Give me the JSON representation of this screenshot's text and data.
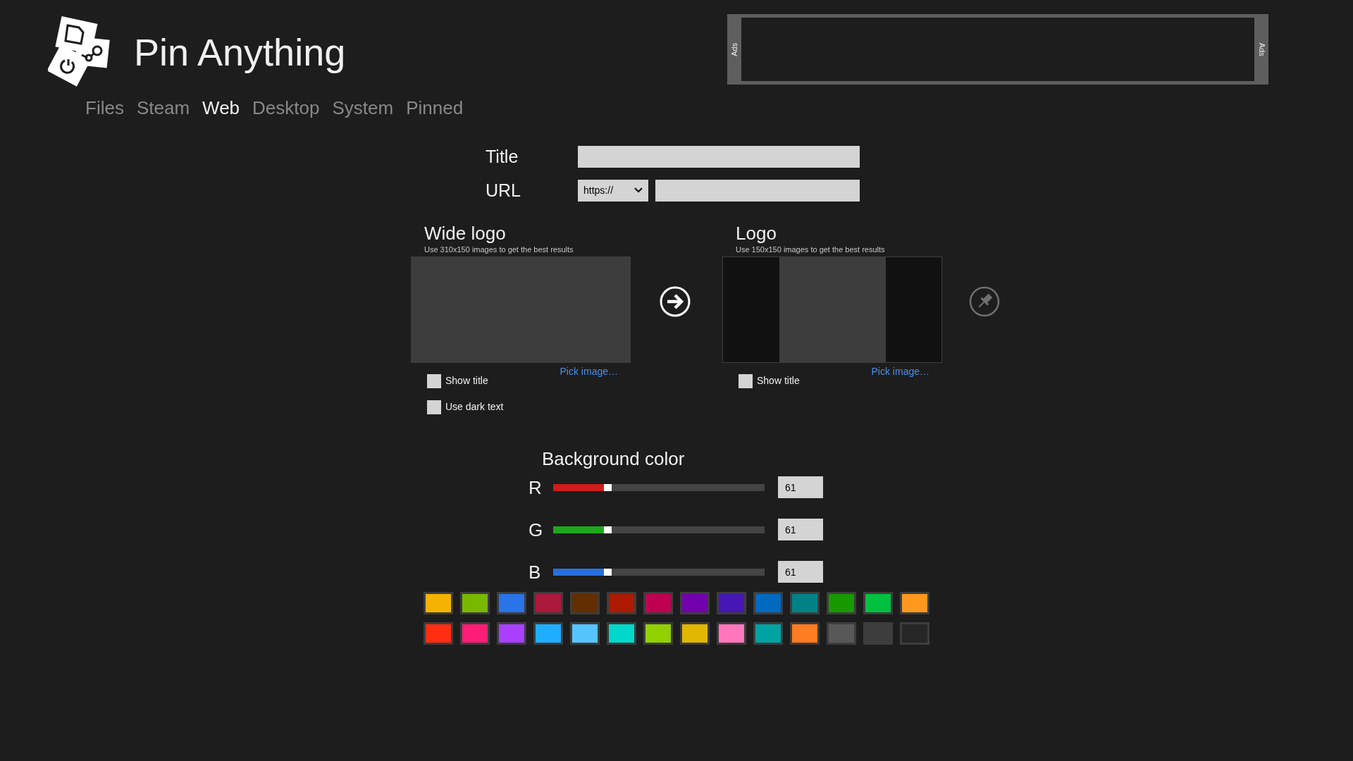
{
  "app": {
    "title": "Pin Anything"
  },
  "tabs": [
    {
      "label": "Files",
      "selected": false
    },
    {
      "label": "Steam",
      "selected": false
    },
    {
      "label": "Web",
      "selected": true
    },
    {
      "label": "Desktop",
      "selected": false
    },
    {
      "label": "System",
      "selected": false
    },
    {
      "label": "Pinned",
      "selected": false
    }
  ],
  "ads": {
    "left_label": "Ads",
    "right_label": "Ads"
  },
  "form": {
    "title_label": "Title",
    "url_label": "URL",
    "url_scheme": "https://"
  },
  "tiles": [
    {
      "kind": "wide",
      "heading": "Wide logo",
      "hint": "Use 310x150 images to get the best results",
      "pick_link": "Pick image…",
      "options": [
        {
          "label": "Show title",
          "checked": false
        },
        {
          "label": "Use dark text",
          "checked": false
        }
      ]
    },
    {
      "kind": "square",
      "heading": "Logo",
      "hint": "Use 150x150 images to get the best results",
      "pick_link": "Pick image…",
      "options": [
        {
          "label": "Show title",
          "checked": false
        }
      ]
    }
  ],
  "pin_button": {
    "disabled": true
  },
  "background": {
    "heading": "Background color",
    "channels": [
      {
        "name": "R",
        "color": "#d01c1c",
        "level": 0.24,
        "value": "61"
      },
      {
        "name": "G",
        "color": "#1ea81e",
        "level": 0.24,
        "value": "61"
      },
      {
        "name": "B",
        "color": "#2670e0",
        "level": 0.24,
        "value": "61"
      }
    ]
  },
  "swatches": [
    {
      "color": "#f4b300"
    },
    {
      "color": "#78b800"
    },
    {
      "color": "#2874e8"
    },
    {
      "color": "#ac193d"
    },
    {
      "color": "#632f00"
    },
    {
      "color": "#ac1a00"
    },
    {
      "color": "#bf0050"
    },
    {
      "color": "#7200ac"
    },
    {
      "color": "#4617b4"
    },
    {
      "color": "#006ac1"
    },
    {
      "color": "#008287"
    },
    {
      "color": "#199900"
    },
    {
      "color": "#00c13f"
    },
    {
      "color": "#ff981d"
    },
    {
      "color": "#ff2e12"
    },
    {
      "color": "#ff1d77"
    },
    {
      "color": "#aa40ff"
    },
    {
      "color": "#1faeff"
    },
    {
      "color": "#56c5ff"
    },
    {
      "color": "#00d8cc"
    },
    {
      "color": "#91d100"
    },
    {
      "color": "#e1b700"
    },
    {
      "color": "#ff76bc"
    },
    {
      "color": "#00a3a3"
    },
    {
      "color": "#fe7c22"
    },
    {
      "color": "#585858"
    },
    {
      "color": "#3d3d3d"
    },
    {
      "color": "#262626"
    }
  ]
}
